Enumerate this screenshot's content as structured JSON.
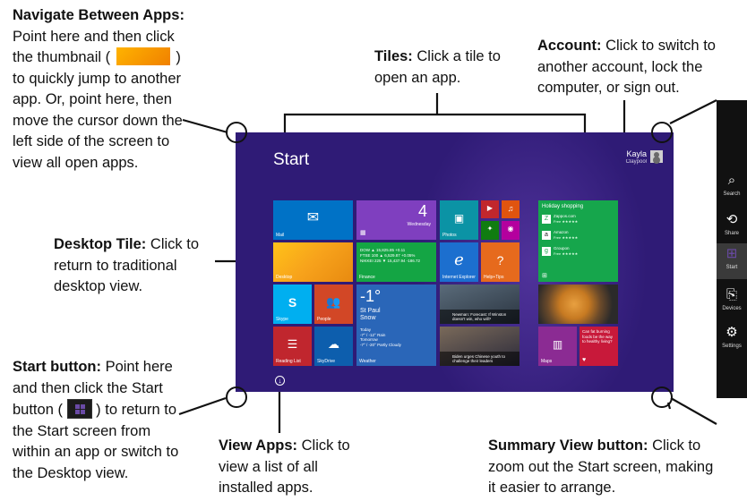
{
  "annotations": {
    "navigate": {
      "title": "Navigate Between Apps:",
      "text_a": "Point here and then click the thumbnail (",
      "text_b": ") to quickly jump to another app. Or, point here, then move the cursor down the left side of the screen to view all open apps."
    },
    "tiles": {
      "title": "Tiles:",
      "text": "Click a tile to open an app."
    },
    "account": {
      "title": "Account:",
      "text": "Click to switch to another account, lock the computer, or sign out."
    },
    "desktop": {
      "title": "Desktop Tile:",
      "text": "Click to return to traditional desktop view."
    },
    "start_button": {
      "title": "Start button:",
      "text_a": "Point here and then click the Start button (",
      "text_b": ") to return to the Start screen from within an app or switch to the Desktop view."
    },
    "view_apps": {
      "title": "View Apps:",
      "text": "Click to view a list of all installed apps."
    },
    "summary": {
      "title": "Summary View button:",
      "text": "Click to zoom out the Start screen, making it easier to arrange."
    }
  },
  "start_screen": {
    "title": "Start",
    "user_name": "Kayla",
    "user_sub": "Claypool",
    "tiles": {
      "mail": "Mail",
      "calendar_num": "4",
      "calendar_day": "Wednesday",
      "photos": "Photos",
      "desktop": "Desktop",
      "finance": "Finance",
      "finance_rows": [
        "DOW  ▲ 15,825.85 +0.11",
        "FTSE 100  ▲ 6,529.87 +0.05%",
        "NIKKEI 225  ▼ 15,437.94 -186.72"
      ],
      "ie": "Internet Explorer",
      "help": "Help+Tips",
      "skype": "Skype",
      "people": "People",
      "weather_temp": "-1°",
      "weather_city": "St Paul",
      "weather_cond": "Snow",
      "weather_today": "Today",
      "weather_today_val": "-7° / -12° Rain",
      "weather_tomorrow": "Tomorrow",
      "weather_tomorrow_val": "-7° / -20° Partly Cloudy",
      "weather": "Weather",
      "news_headline": "Newman: Forecast: If Winston doesn't win, who will?",
      "news_headline2": "Biden urges Chinese youth to challenge their leaders",
      "reading_list": "Reading List",
      "skydrive": "SkyDrive",
      "store_header": "Holiday shopping",
      "store_items": [
        "Zappos.com",
        "Amazon",
        "Groupon"
      ],
      "store_rating": "Free ★★★★★",
      "food_text": "Can fat burning foods be the way to healthy living?",
      "maps": "Maps"
    }
  },
  "charms": [
    {
      "label": "Search",
      "icon": "search-icon"
    },
    {
      "label": "Share",
      "icon": "share-icon"
    },
    {
      "label": "Start",
      "icon": "windows-icon"
    },
    {
      "label": "Devices",
      "icon": "devices-icon"
    },
    {
      "label": "Settings",
      "icon": "gear-icon"
    }
  ],
  "colors": {
    "start_bg": "#2f1b76",
    "mail": "#0072c6",
    "calendar": "#7f3fbf",
    "photos": "#0b93a5",
    "desktop": "#f5a623",
    "finance": "#14a544",
    "ie": "#1c6fcf",
    "help": "#e66a1d",
    "skype": "#00aff0",
    "people": "#d24726",
    "reading_list": "#c0262e",
    "skydrive": "#0d5ead",
    "store": "#16a64c",
    "maps": "#8b2b93",
    "charms_bg": "#111111"
  }
}
